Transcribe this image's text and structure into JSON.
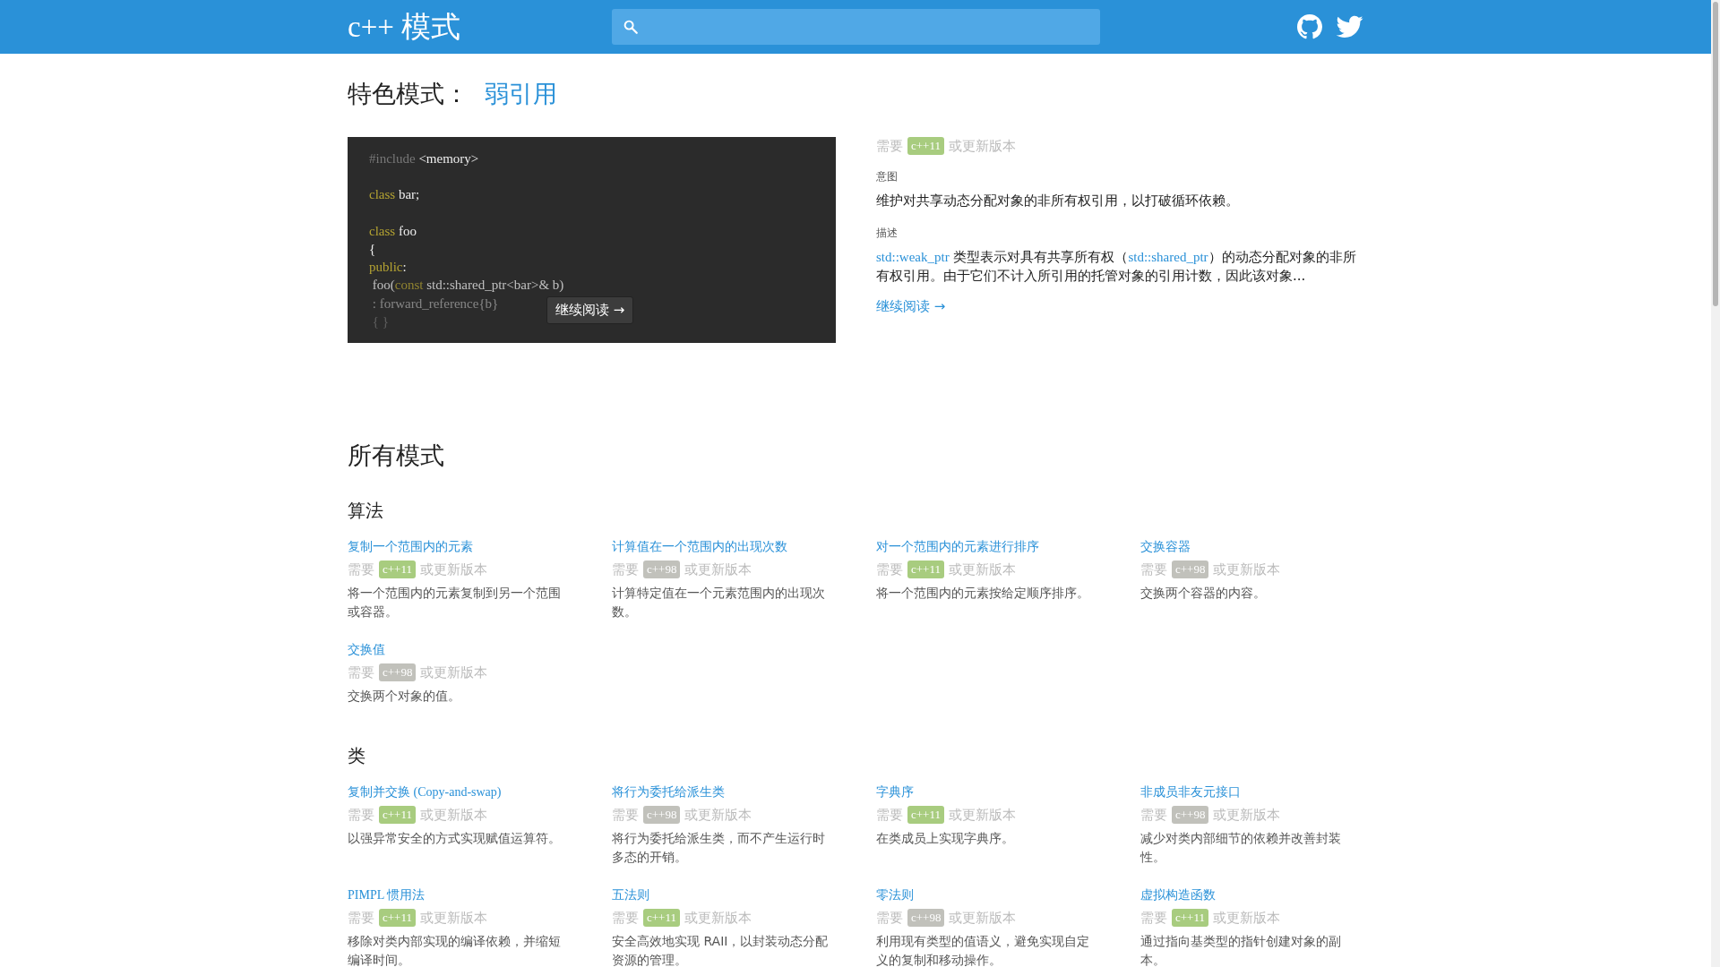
{
  "header": {
    "logo": "c++ 模式"
  },
  "featured": {
    "label": "特色模式：",
    "title": "弱引用",
    "code": {
      "lines": [
        {
          "tokens": [
            {
              "kind": "preproc",
              "text": "#include"
            },
            {
              "kind": "plain",
              "text": " <memory>"
            }
          ]
        },
        {
          "blank_before": true,
          "tokens": [
            {
              "kind": "keyword",
              "text": "class"
            },
            {
              "kind": "plain",
              "text": " bar;"
            }
          ]
        },
        {
          "blank_before": true,
          "tokens": [
            {
              "kind": "keyword",
              "text": "class"
            },
            {
              "kind": "plain",
              "text": " foo"
            }
          ]
        },
        {
          "tokens": [
            {
              "kind": "plain",
              "text": "{"
            }
          ]
        },
        {
          "tokens": [
            {
              "kind": "keyword",
              "text": "public"
            },
            {
              "kind": "plain",
              "text": ":"
            }
          ]
        },
        {
          "tokens": [
            {
              "kind": "plain",
              "text": " foo("
            },
            {
              "kind": "keyword",
              "text": "const"
            },
            {
              "kind": "plain",
              "text": " std::shared_ptr<bar>& b)"
            }
          ]
        },
        {
          "tokens": [
            {
              "kind": "plain",
              "text": " : forward_reference{b}"
            }
          ]
        },
        {
          "tokens": [
            {
              "kind": "plain",
              "text": " { }"
            }
          ]
        }
      ],
      "button": "继续阅读 →"
    },
    "requires": {
      "prefix": "需要",
      "version": "c++11",
      "color": "#a8cc7f",
      "suffix": "或更新版本"
    },
    "intent_label": "意图",
    "intent": "维护对共享动态分配对象的非所有权引用，以打破循环依赖。",
    "description_label": "描述",
    "description": [
      {
        "kind": "link",
        "text": "std::weak_ptr"
      },
      {
        "kind": "text",
        "text": " 类型表示对具有共享所有权（"
      },
      {
        "kind": "link",
        "text": "std::shared_ptr"
      },
      {
        "kind": "text",
        "text": "）的动态分配对象的非所有权引用。由于它们不计入所引用的托管对象的引用计数，因此该对象..."
      }
    ],
    "read_more": "继续阅读 →"
  },
  "all_title": "所有模式",
  "sections": [
    {
      "title": "算法",
      "items": [
        {
          "title": "复制一个范围内的元素",
          "requires": {
            "prefix": "需要",
            "version": "c++11",
            "color": "#a8cc7f",
            "suffix": "或更新版本"
          },
          "description": "将一个范围内的元素复制到另一个范围或容器。"
        },
        {
          "title": "计算值在一个范围内的出现次数",
          "requires": {
            "prefix": "需要",
            "version": "c++98",
            "color": "#c1c1bb",
            "suffix": "或更新版本"
          },
          "description": "计算特定值在一个元素范围内的出现次数。"
        },
        {
          "title": "对一个范围内的元素进行排序",
          "requires": {
            "prefix": "需要",
            "version": "c++11",
            "color": "#a8cc7f",
            "suffix": "或更新版本"
          },
          "description": "将一个范围内的元素按给定顺序排序。"
        },
        {
          "title": "交换容器",
          "requires": {
            "prefix": "需要",
            "version": "c++98",
            "color": "#c1c1bb",
            "suffix": "或更新版本"
          },
          "description": "交换两个容器的内容。"
        },
        {
          "title": "交换值",
          "requires": {
            "prefix": "需要",
            "version": "c++98",
            "color": "#c1c1bb",
            "suffix": "或更新版本"
          },
          "description": "交换两个对象的值。"
        }
      ]
    },
    {
      "title": "类",
      "items": [
        {
          "title": "复制并交换 (Copy-and-swap)",
          "requires": {
            "prefix": "需要",
            "version": "c++11",
            "color": "#a8cc7f",
            "suffix": "或更新版本"
          },
          "description": "以强异常安全的方式实现赋值运算符。"
        },
        {
          "title": "将行为委托给派生类",
          "requires": {
            "prefix": "需要",
            "version": "c++98",
            "color": "#c1c1bb",
            "suffix": "或更新版本"
          },
          "description": "将行为委托给派生类，而不产生运行时多态的开销。"
        },
        {
          "title": "字典序",
          "requires": {
            "prefix": "需要",
            "version": "c++11",
            "color": "#a8cc7f",
            "suffix": "或更新版本"
          },
          "description": "在类成员上实现字典序。"
        },
        {
          "title": "非成员非友元接口",
          "requires": {
            "prefix": "需要",
            "version": "c++98",
            "color": "#c1c1bb",
            "suffix": "或更新版本"
          },
          "description": "减少对类内部细节的依赖并改善封装性。"
        },
        {
          "title": "PIMPL 惯用法",
          "requires": {
            "prefix": "需要",
            "version": "c++11",
            "color": "#a8cc7f",
            "suffix": "或更新版本"
          },
          "description": "移除对类内部实现的编译依赖，并缩短编译时间。"
        },
        {
          "title": "五法则",
          "requires": {
            "prefix": "需要",
            "version": "c++11",
            "color": "#a8cc7f",
            "suffix": "或更新版本"
          },
          "description": "安全高效地实现 RAII，以封装动态分配资源的管理。"
        },
        {
          "title": "零法则",
          "requires": {
            "prefix": "需要",
            "version": "c++98",
            "color": "#c1c1bb",
            "suffix": "或更新版本"
          },
          "description": "利用现有类型的值语义，避免实现自定义的复制和移动操作。"
        },
        {
          "title": "虚拟构造函数",
          "requires": {
            "prefix": "需要",
            "version": "c++11",
            "color": "#a8cc7f",
            "suffix": "或更新版本"
          },
          "description": "通过指向基类型的指针创建对象的副本。"
        }
      ]
    }
  ]
}
